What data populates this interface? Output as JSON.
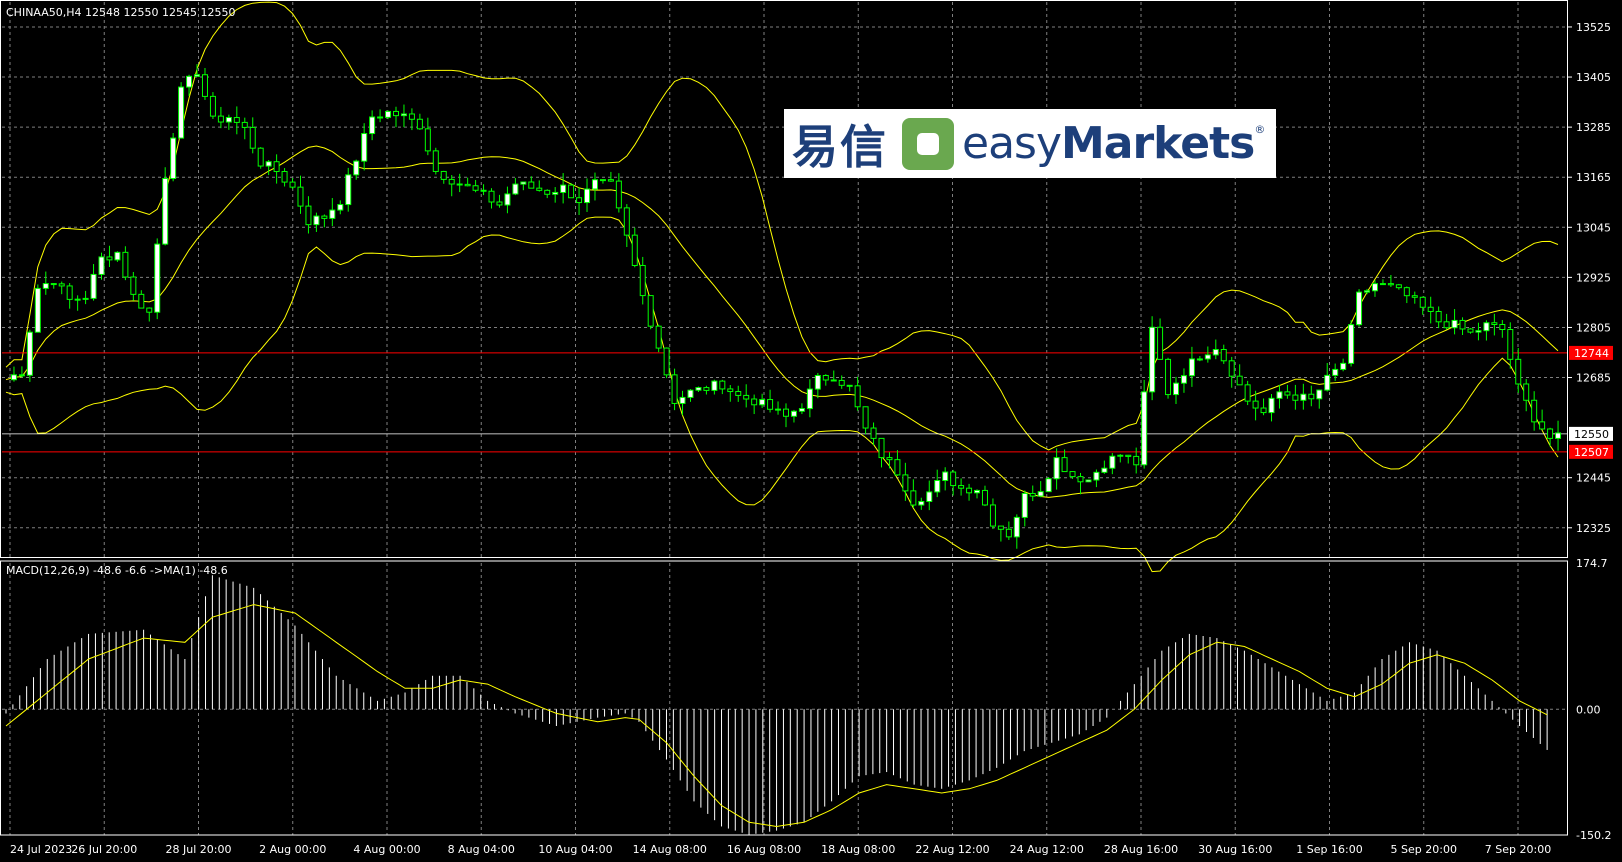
{
  "header": {
    "symbol_line": "CHINAA50,H4  12548 12550 12545 12550",
    "macd_line": "MACD(12,26,9) -48.6 -6.6  ->MA(1) -48.6"
  },
  "logo": {
    "cn_text": "易信",
    "en_light": "easy",
    "en_bold": "Markets",
    "reg": "®"
  },
  "colors": {
    "background": "#000000",
    "grid": "#7f7f7f",
    "bull_candle": "#ffffff",
    "bear_candle": "#000000",
    "wick": "#00ff00",
    "bands": "#ffff00",
    "hline": "#ff0000",
    "macd_hist": "#ffffff",
    "signal": "#ffff00"
  },
  "chart_data": [
    {
      "type": "candlestick",
      "symbol": "CHINAA50",
      "timeframe": "H4",
      "ylim": [
        12255,
        13580
      ],
      "yticks": [
        13525,
        13405,
        13285,
        13165,
        13045,
        12925,
        12805,
        12685,
        12445,
        12325
      ],
      "xtick_labels": [
        "24 Jul 2023",
        "26 Jul 20:00",
        "28 Jul 20:00",
        "2 Aug 00:00",
        "4 Aug 00:00",
        "8 Aug 04:00",
        "10 Aug 04:00",
        "14 Aug 08:00",
        "16 Aug 08:00",
        "18 Aug 08:00",
        "22 Aug 12:00",
        "24 Aug 12:00",
        "28 Aug 16:00",
        "30 Aug 16:00",
        "1 Sep 16:00",
        "5 Sep 20:00",
        "7 Sep 20:00"
      ],
      "current_price": 12550,
      "current_label": "12550",
      "levels": [
        {
          "value": 12744,
          "label": "12744"
        },
        {
          "value": 12507,
          "label": "12507"
        }
      ],
      "close_path": [
        [
          0,
          12680
        ],
        [
          2,
          12700
        ],
        [
          4,
          12900
        ],
        [
          6,
          12920
        ],
        [
          8,
          12870
        ],
        [
          10,
          12880
        ],
        [
          12,
          12970
        ],
        [
          14,
          12985
        ],
        [
          16,
          12880
        ],
        [
          18,
          12840
        ],
        [
          20,
          13170
        ],
        [
          22,
          13370
        ],
        [
          24,
          13420
        ],
        [
          26,
          13300
        ],
        [
          28,
          13310
        ],
        [
          30,
          13280
        ],
        [
          32,
          13200
        ],
        [
          34,
          13180
        ],
        [
          36,
          13140
        ],
        [
          38,
          13060
        ],
        [
          40,
          13070
        ],
        [
          42,
          13110
        ],
        [
          44,
          13210
        ],
        [
          46,
          13310
        ],
        [
          48,
          13320
        ],
        [
          50,
          13310
        ],
        [
          52,
          13290
        ],
        [
          54,
          13180
        ],
        [
          56,
          13160
        ],
        [
          58,
          13140
        ],
        [
          60,
          13120
        ],
        [
          62,
          13100
        ],
        [
          64,
          13150
        ],
        [
          66,
          13140
        ],
        [
          68,
          13130
        ],
        [
          70,
          13140
        ],
        [
          72,
          13110
        ],
        [
          74,
          13150
        ],
        [
          76,
          13145
        ],
        [
          78,
          13020
        ],
        [
          80,
          12880
        ],
        [
          82,
          12760
        ],
        [
          84,
          12630
        ],
        [
          86,
          12650
        ],
        [
          88,
          12660
        ],
        [
          90,
          12670
        ],
        [
          92,
          12640
        ],
        [
          94,
          12630
        ],
        [
          96,
          12610
        ],
        [
          98,
          12590
        ],
        [
          100,
          12620
        ],
        [
          102,
          12680
        ],
        [
          104,
          12690
        ],
        [
          106,
          12660
        ],
        [
          108,
          12560
        ],
        [
          110,
          12500
        ],
        [
          112,
          12460
        ],
        [
          114,
          12390
        ],
        [
          116,
          12410
        ],
        [
          118,
          12450
        ],
        [
          120,
          12420
        ],
        [
          122,
          12420
        ],
        [
          124,
          12340
        ],
        [
          126,
          12310
        ],
        [
          128,
          12400
        ],
        [
          130,
          12420
        ],
        [
          132,
          12490
        ],
        [
          134,
          12450
        ],
        [
          136,
          12440
        ],
        [
          138,
          12480
        ],
        [
          140,
          12500
        ],
        [
          142,
          12480
        ],
        [
          144,
          12800
        ],
        [
          146,
          12650
        ],
        [
          148,
          12700
        ],
        [
          150,
          12740
        ],
        [
          152,
          12760
        ],
        [
          154,
          12700
        ],
        [
          156,
          12630
        ],
        [
          158,
          12600
        ],
        [
          160,
          12650
        ],
        [
          162,
          12640
        ],
        [
          164,
          12630
        ],
        [
          166,
          12680
        ],
        [
          168,
          12720
        ],
        [
          170,
          12880
        ],
        [
          172,
          12910
        ],
        [
          174,
          12900
        ],
        [
          176,
          12880
        ],
        [
          178,
          12850
        ],
        [
          180,
          12820
        ],
        [
          182,
          12810
        ],
        [
          184,
          12790
        ],
        [
          186,
          12810
        ],
        [
          188,
          12800
        ],
        [
          190,
          12660
        ],
        [
          192,
          12590
        ],
        [
          194,
          12540
        ]
      ],
      "series": [
        {
          "name": "Bollinger Bands",
          "type": "line"
        },
        {
          "name": "MACD(12,26,9)"
        }
      ]
    },
    {
      "type": "bar",
      "indicator": "MACD(12,26,9)",
      "values_printed": {
        "macd": -48.6,
        "signal": -6.6,
        "ma": -48.6
      },
      "ylim": [
        -150.2,
        174.7
      ],
      "yticks": [
        {
          "value": 174.7,
          "label": "174.7"
        },
        {
          "value": 0,
          "label": "0.00"
        },
        {
          "value": -150.2,
          "label": "-150.2"
        }
      ],
      "hist_path": [
        [
          0,
          -5
        ],
        [
          6,
          60
        ],
        [
          12,
          90
        ],
        [
          20,
          95
        ],
        [
          26,
          60
        ],
        [
          30,
          160
        ],
        [
          36,
          145
        ],
        [
          42,
          100
        ],
        [
          48,
          40
        ],
        [
          54,
          10
        ],
        [
          58,
          20
        ],
        [
          62,
          40
        ],
        [
          66,
          40
        ],
        [
          70,
          10
        ],
        [
          74,
          -5
        ],
        [
          80,
          -20
        ],
        [
          86,
          -10
        ],
        [
          90,
          -5
        ],
        [
          92,
          -15
        ],
        [
          96,
          -60
        ],
        [
          100,
          -110
        ],
        [
          104,
          -140
        ],
        [
          108,
          -150
        ],
        [
          112,
          -145
        ],
        [
          116,
          -135
        ],
        [
          120,
          -110
        ],
        [
          124,
          -80
        ],
        [
          128,
          -75
        ],
        [
          132,
          -90
        ],
        [
          136,
          -95
        ],
        [
          140,
          -85
        ],
        [
          144,
          -70
        ],
        [
          148,
          -50
        ],
        [
          152,
          -40
        ],
        [
          156,
          -30
        ],
        [
          160,
          -10
        ],
        [
          164,
          30
        ],
        [
          168,
          70
        ],
        [
          172,
          90
        ],
        [
          176,
          85
        ],
        [
          180,
          70
        ],
        [
          184,
          50
        ],
        [
          188,
          30
        ],
        [
          192,
          10
        ],
        [
          196,
          20
        ],
        [
          200,
          60
        ],
        [
          204,
          80
        ],
        [
          208,
          70
        ],
        [
          212,
          40
        ],
        [
          216,
          10
        ],
        [
          220,
          -20
        ],
        [
          224,
          -48.6
        ]
      ],
      "signal_path": [
        [
          0,
          -20
        ],
        [
          6,
          20
        ],
        [
          12,
          60
        ],
        [
          20,
          85
        ],
        [
          26,
          80
        ],
        [
          30,
          110
        ],
        [
          36,
          125
        ],
        [
          42,
          115
        ],
        [
          48,
          80
        ],
        [
          54,
          45
        ],
        [
          58,
          25
        ],
        [
          62,
          25
        ],
        [
          66,
          35
        ],
        [
          70,
          30
        ],
        [
          74,
          15
        ],
        [
          80,
          -5
        ],
        [
          86,
          -15
        ],
        [
          90,
          -10
        ],
        [
          92,
          -12
        ],
        [
          96,
          -40
        ],
        [
          100,
          -80
        ],
        [
          104,
          -115
        ],
        [
          108,
          -135
        ],
        [
          112,
          -140
        ],
        [
          116,
          -135
        ],
        [
          120,
          -120
        ],
        [
          124,
          -100
        ],
        [
          128,
          -90
        ],
        [
          132,
          -95
        ],
        [
          136,
          -100
        ],
        [
          140,
          -95
        ],
        [
          144,
          -85
        ],
        [
          148,
          -70
        ],
        [
          152,
          -55
        ],
        [
          156,
          -40
        ],
        [
          160,
          -25
        ],
        [
          164,
          0
        ],
        [
          168,
          35
        ],
        [
          172,
          65
        ],
        [
          176,
          80
        ],
        [
          180,
          75
        ],
        [
          184,
          60
        ],
        [
          188,
          45
        ],
        [
          192,
          25
        ],
        [
          196,
          15
        ],
        [
          200,
          30
        ],
        [
          204,
          55
        ],
        [
          208,
          65
        ],
        [
          212,
          55
        ],
        [
          216,
          35
        ],
        [
          220,
          10
        ],
        [
          224,
          -6.6
        ]
      ]
    }
  ]
}
